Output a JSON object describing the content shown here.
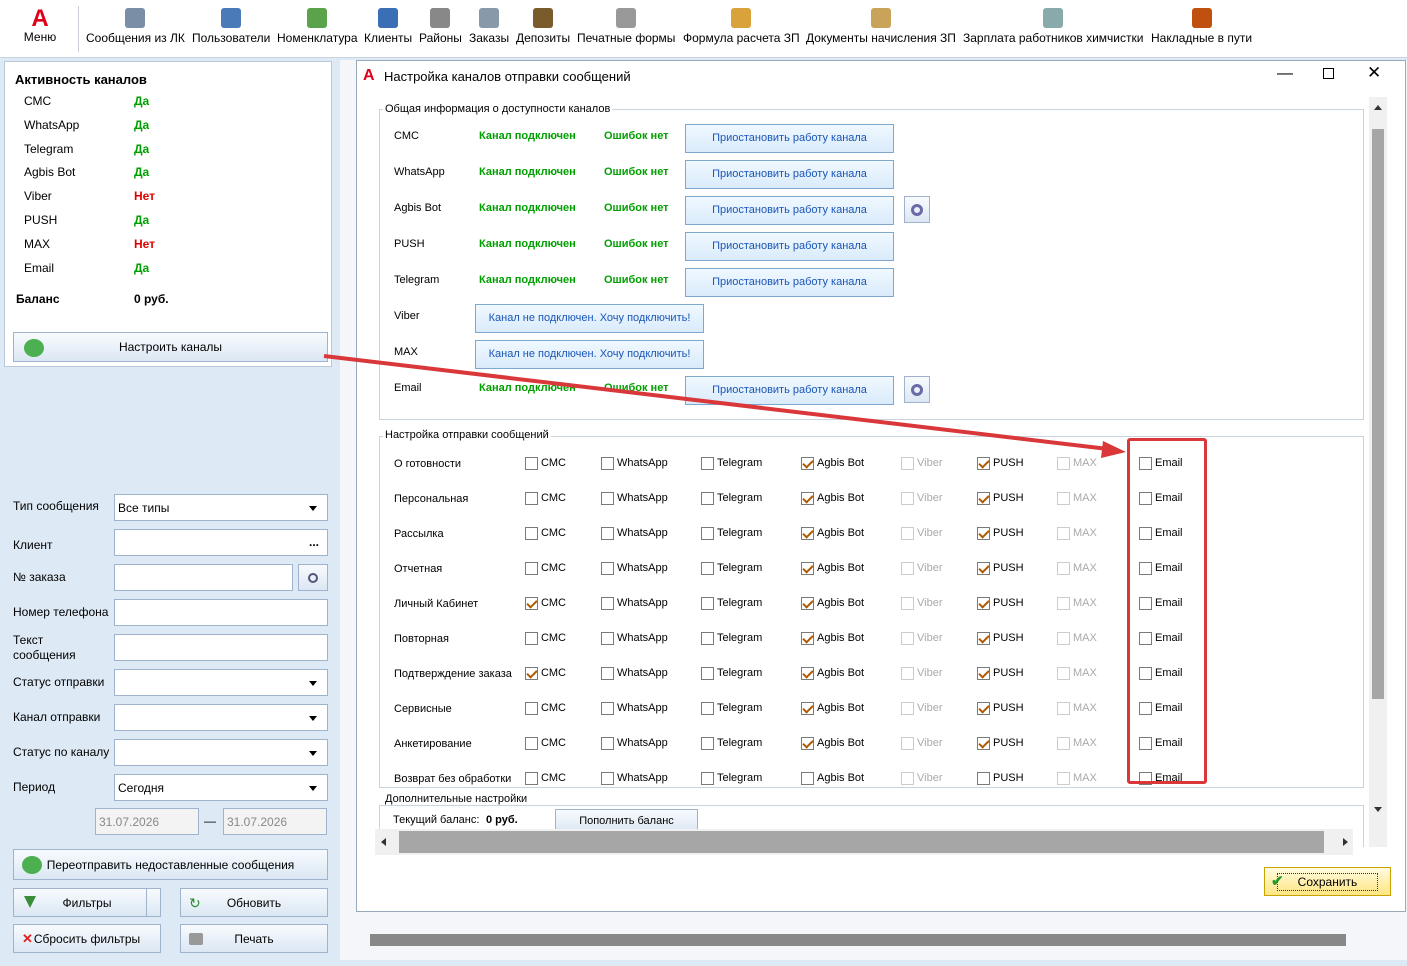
{
  "toolbar": {
    "menu": "Меню",
    "items": [
      "Сообщения из ЛК",
      "Пользователи",
      "Номенклатура",
      "Клиенты",
      "Районы",
      "Заказы",
      "Депозиты",
      "Печатные формы",
      "Формула расчета ЗП",
      "Документы начисления ЗП",
      "Зарплата работников химчистки",
      "Накладные в пути"
    ]
  },
  "activity": {
    "title": "Активность каналов",
    "rows": [
      {
        "name": "СМС",
        "value": "Да"
      },
      {
        "name": "WhatsApp",
        "value": "Да"
      },
      {
        "name": "Telegram",
        "value": "Да"
      },
      {
        "name": "Agbis Bot",
        "value": "Да"
      },
      {
        "name": "Viber",
        "value": "Нет"
      },
      {
        "name": "PUSH",
        "value": "Да"
      },
      {
        "name": "MAX",
        "value": "Нет"
      },
      {
        "name": "Email",
        "value": "Да"
      }
    ],
    "balance_label": "Баланс",
    "balance_value": "0 руб.",
    "setup_button": "Настроить каналы"
  },
  "filters": {
    "type_label": "Тип сообщения",
    "type_value": "Все типы",
    "client_label": "Клиент",
    "order_label": "№ заказа",
    "phone_label": "Номер телефона",
    "text_label": "Текст сообщения",
    "status_label": "Статус отправки",
    "channel_label": "Канал отправки",
    "chstatus_label": "Статус по каналу",
    "period_label": "Период",
    "period_value": "Сегодня",
    "date_from": "31.07.2026",
    "date_to": "31.07.2026",
    "dash": "—",
    "resend": "Переотправить недоставленные сообщения",
    "filters": "Фильтры",
    "refresh": "Обновить",
    "reset": "Сбросить фильтры",
    "print": "Печать"
  },
  "dialog": {
    "title": "Настройка каналов отправки сообщений",
    "group1": "Общая информация о доступности каналов",
    "channels": [
      {
        "name": "СМС",
        "status": "Канал подключен",
        "errors": "Ошибок нет",
        "button": "Приостановить работу канала",
        "gear": false
      },
      {
        "name": "WhatsApp",
        "status": "Канал подключен",
        "errors": "Ошибок нет",
        "button": "Приостановить работу канала",
        "gear": false
      },
      {
        "name": "Agbis Bot",
        "status": "Канал подключен",
        "errors": "Ошибок нет",
        "button": "Приостановить работу канала",
        "gear": true
      },
      {
        "name": "PUSH",
        "status": "Канал подключен",
        "errors": "Ошибок нет",
        "button": "Приостановить работу канала",
        "gear": false
      },
      {
        "name": "Telegram",
        "status": "Канал подключен",
        "errors": "Ошибок нет",
        "button": "Приостановить работу канала",
        "gear": false
      },
      {
        "name": "Viber",
        "connect": "Канал не подключен. Хочу подключить!"
      },
      {
        "name": "MAX",
        "connect": "Канал не подключен. Хочу подключить!"
      },
      {
        "name": "Email",
        "status": "Канал подключен",
        "errors": "Ошибок нет",
        "button": "Приостановить работу канала",
        "gear": true
      }
    ],
    "group2": "Настройка отправки сообщений",
    "col_labels": [
      "СМС",
      "WhatsApp",
      "Telegram",
      "Agbis Bot",
      "Viber",
      "PUSH",
      "MAX",
      "Email"
    ],
    "rows": [
      {
        "name": "О готовности",
        "checks": [
          0,
          0,
          0,
          1,
          0,
          1,
          0,
          0
        ]
      },
      {
        "name": "Персональная",
        "checks": [
          0,
          0,
          0,
          1,
          0,
          1,
          0,
          0
        ]
      },
      {
        "name": "Рассылка",
        "checks": [
          0,
          0,
          0,
          1,
          0,
          1,
          0,
          0
        ]
      },
      {
        "name": "Отчетная",
        "checks": [
          0,
          0,
          0,
          1,
          0,
          1,
          0,
          0
        ]
      },
      {
        "name": "Личный Кабинет",
        "checks": [
          1,
          0,
          0,
          1,
          0,
          1,
          0,
          0
        ]
      },
      {
        "name": "Повторная",
        "checks": [
          0,
          0,
          0,
          1,
          0,
          1,
          0,
          0
        ]
      },
      {
        "name": "Подтверждение заказа",
        "checks": [
          1,
          0,
          0,
          1,
          0,
          1,
          0,
          0
        ]
      },
      {
        "name": "Сервисные",
        "checks": [
          0,
          0,
          0,
          1,
          0,
          1,
          0,
          0
        ]
      },
      {
        "name": "Анкетирование",
        "checks": [
          0,
          0,
          0,
          1,
          0,
          1,
          0,
          0
        ]
      },
      {
        "name": "Возврат без обработки",
        "checks": [
          0,
          0,
          0,
          0,
          0,
          0,
          0,
          0
        ]
      }
    ],
    "group3": "Дополнительные настройки",
    "balance_label": "Текущий баланс:",
    "balance_value": "0 руб.",
    "topup": "Пополнить баланс",
    "save": "Сохранить"
  },
  "colors": {
    "highlight": "#d9373a",
    "arrow": "#d9373a"
  }
}
